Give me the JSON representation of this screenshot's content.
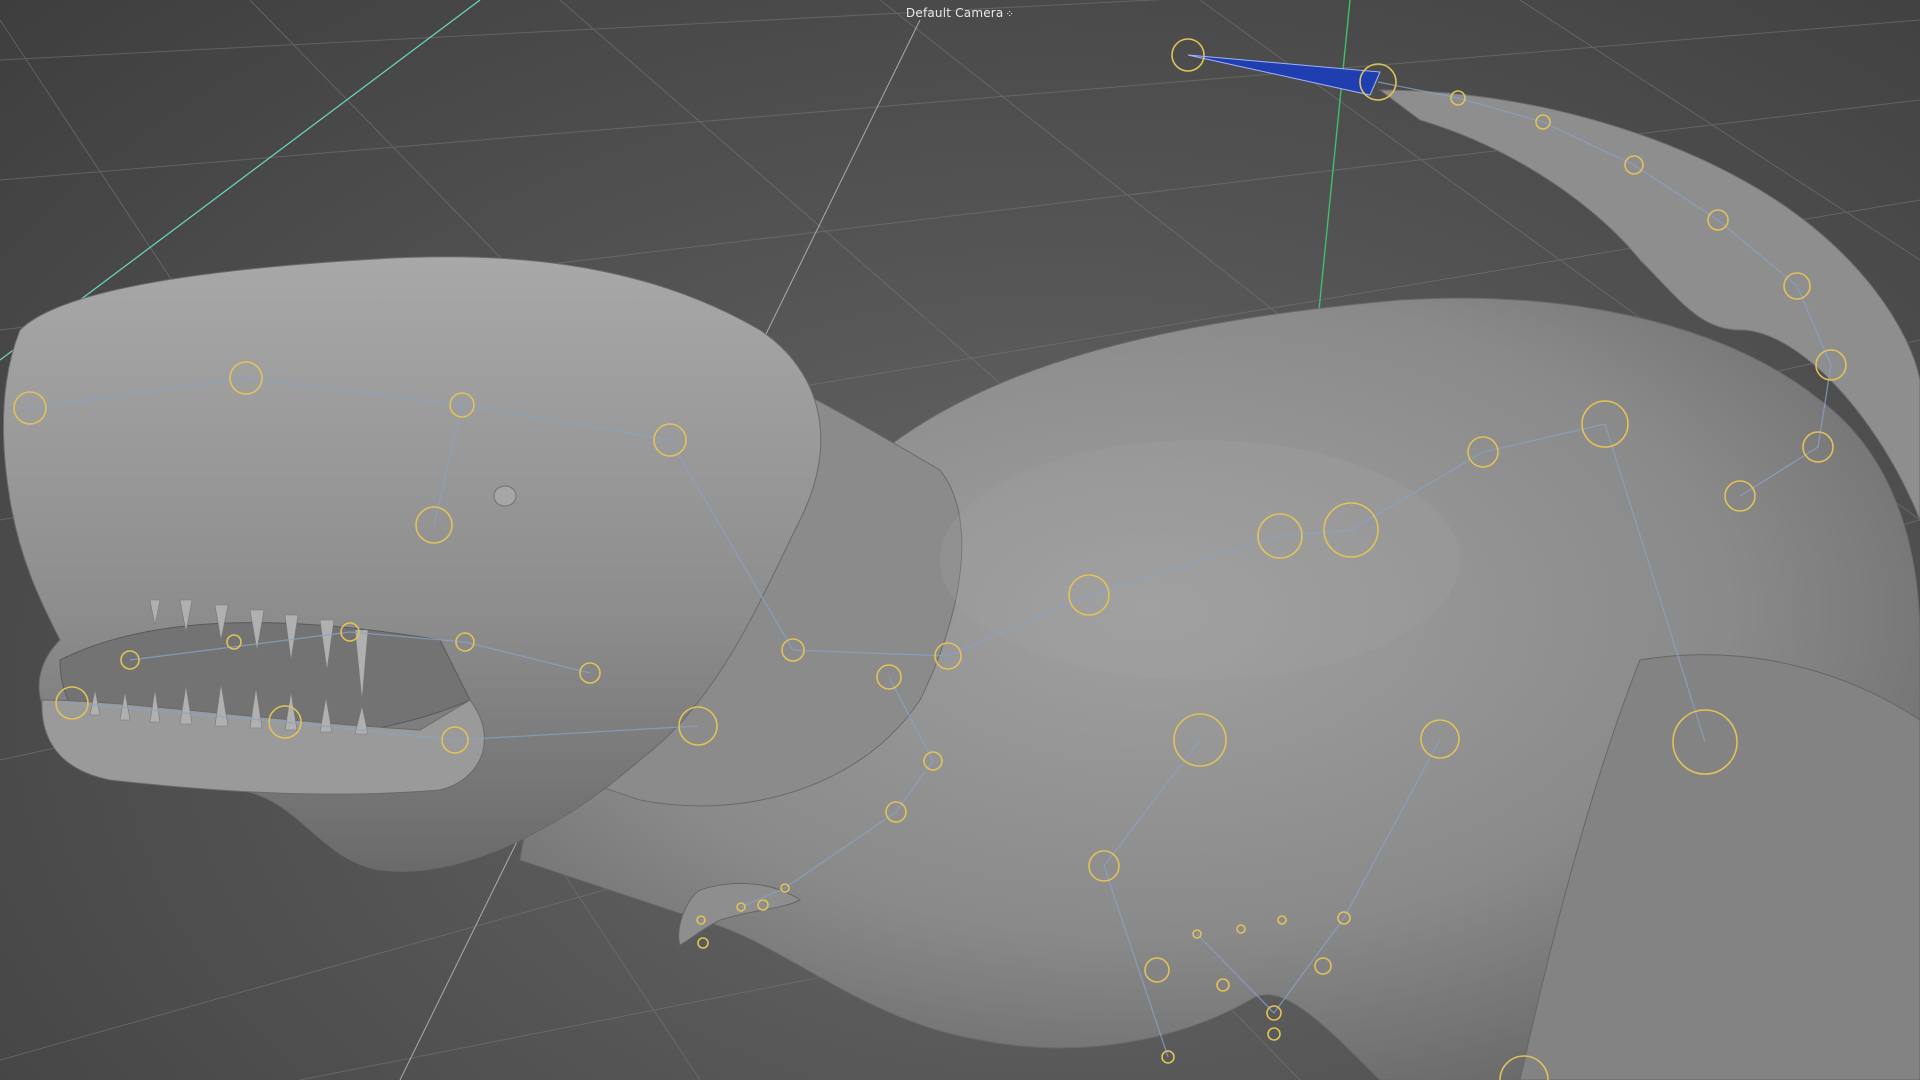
{
  "viewport": {
    "camera_label": "Default Camera",
    "camera_icon": "camera-settings-icon"
  },
  "colors": {
    "background": "#555555",
    "grid": "#7a7a7a",
    "axis_x": "#c04040",
    "axis_y": "#3fbf6a",
    "axis_z": "#6fd6c4",
    "joint": "#e1c25a",
    "bone": "#8aa2c8",
    "selected_bone": "#1f3fb0",
    "mesh": "#8d8d8d"
  },
  "scene": {
    "object": "t-rex-mesh",
    "rig": "skeleton-joints"
  }
}
